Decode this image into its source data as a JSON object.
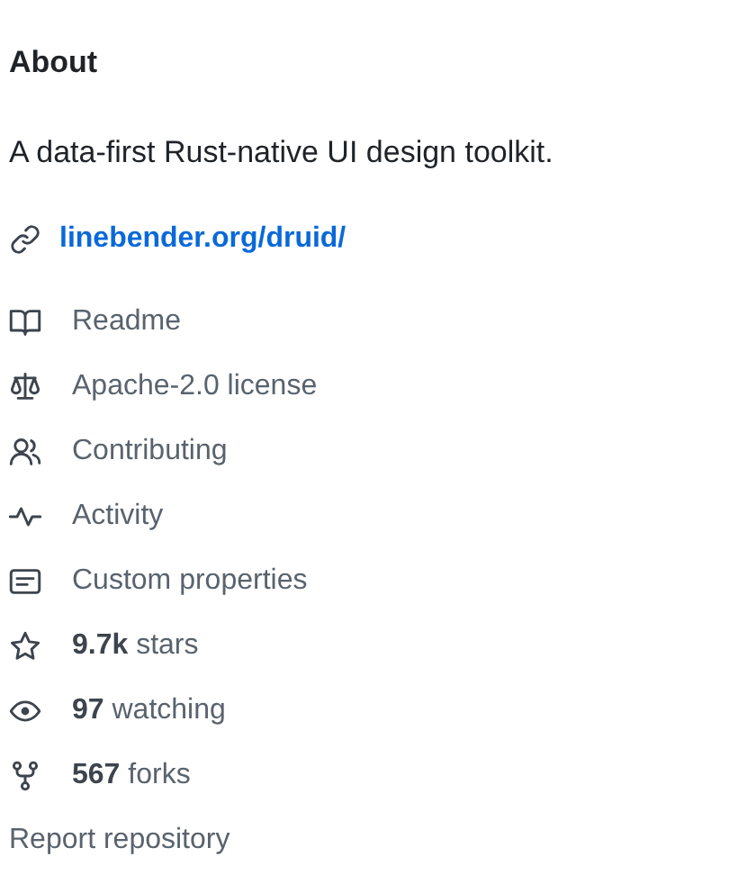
{
  "title": "About",
  "description": "A data-first Rust-native UI design toolkit.",
  "website": "linebender.org/druid/",
  "items": [
    {
      "kind": "readme",
      "label": "Readme"
    },
    {
      "kind": "license",
      "label": "Apache-2.0 license"
    },
    {
      "kind": "contributing",
      "label": "Contributing"
    },
    {
      "kind": "activity",
      "label": "Activity"
    },
    {
      "kind": "properties",
      "label": "Custom properties"
    },
    {
      "kind": "stars",
      "label": "**9.7k** stars"
    },
    {
      "kind": "watchers",
      "label": "**97** watching"
    },
    {
      "kind": "forks",
      "label": "**567** forks"
    }
  ],
  "report": "Report repository"
}
